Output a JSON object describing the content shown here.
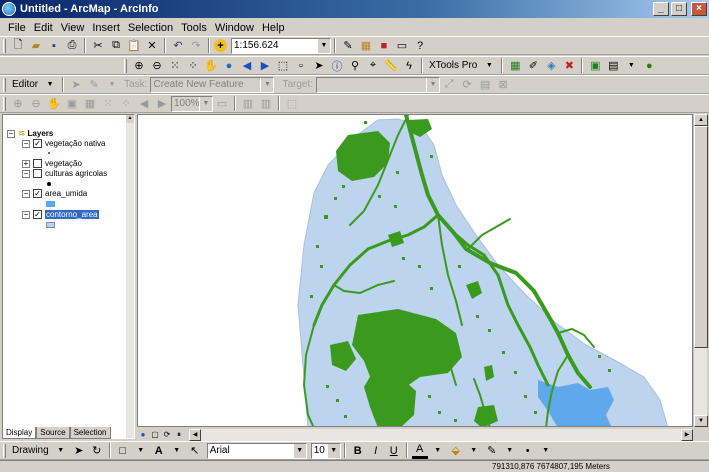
{
  "window": {
    "title": "Untitled - ArcMap - ArcInfo"
  },
  "menu": [
    "File",
    "Edit",
    "View",
    "Insert",
    "Selection",
    "Tools",
    "Window",
    "Help"
  ],
  "standard_toolbar": {
    "scale": "1:156.624"
  },
  "tools_toolbar": {
    "xtools": "XTools Pro"
  },
  "editor_toolbar": {
    "editor_label": "Editor",
    "task_label": "Task:",
    "task_value": "Create New Feature",
    "target_label": "Target:",
    "target_value": ""
  },
  "layout_toolbar": {
    "zoom": "100%"
  },
  "toc": {
    "root": "Layers",
    "layers": [
      {
        "name": "vegetação nativa",
        "checked": true
      },
      {
        "name": "vegetação",
        "checked": false
      },
      {
        "name": "culturas agricolas",
        "checked": false
      },
      {
        "name": "area_umida",
        "checked": true
      },
      {
        "name": "contorno_area",
        "checked": true
      }
    ],
    "tabs": [
      "Display",
      "Source",
      "Selection"
    ]
  },
  "draw_toolbar": {
    "drawing_label": "Drawing",
    "font": "Arial",
    "font_size": "10"
  },
  "status": {
    "coordinates": "791310,876 7674807,195 Meters"
  },
  "colors": {
    "vegetation": "#3a9a1e",
    "boundary": "#bcd4ee",
    "water": "#5fa8ec"
  }
}
